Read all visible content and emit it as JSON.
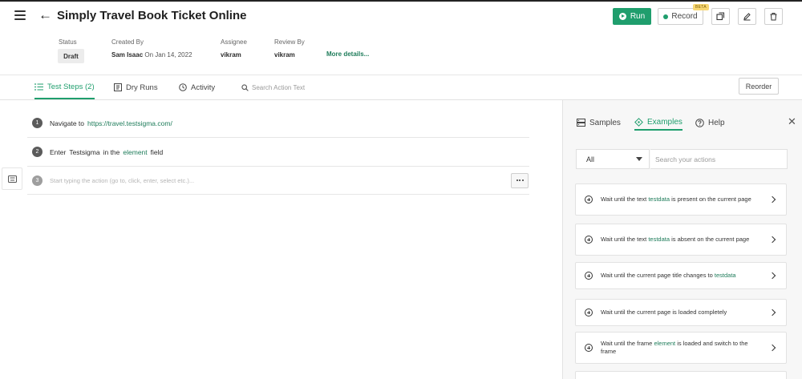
{
  "header": {
    "title": "Simply Travel Book Ticket Online",
    "run_label": "Run",
    "record_label": "Record",
    "beta_label": "BETA"
  },
  "meta": {
    "status_label": "Status",
    "status_value": "Draft",
    "created_label": "Created By",
    "created_by": "Sam Isaac",
    "created_on": "On Jan 14, 2022",
    "assignee_label": "Assignee",
    "assignee": "vikram",
    "review_label": "Review By",
    "reviewer": "vikram",
    "more_details": "More details..."
  },
  "tabs": {
    "test_steps": "Test Steps (2)",
    "dry_runs": "Dry Runs",
    "activity": "Activity",
    "search_placeholder": "Search Action Text",
    "reorder": "Reorder"
  },
  "steps": [
    {
      "num": "1",
      "parts": [
        "Navigate to",
        "https://travel.testsigma.com/"
      ]
    },
    {
      "num": "2",
      "parts": [
        "Enter",
        "Testsigma",
        "in the",
        "element",
        "field"
      ]
    }
  ],
  "new_step": {
    "num": "3",
    "placeholder": "Start typing the action (go to, click, enter, select etc.)..."
  },
  "panel": {
    "tabs": {
      "samples": "Samples",
      "examples": "Examples",
      "help": "Help"
    },
    "filter_value": "All",
    "search_placeholder": "Search your actions",
    "examples": [
      {
        "parts": [
          "Wait until the text",
          "testdata",
          "is present on the current page"
        ]
      },
      {
        "parts": [
          "Wait until the text",
          "testdata",
          "is absent on the current page"
        ]
      },
      {
        "parts": [
          "Wait until the current page title changes to",
          "testdata"
        ]
      },
      {
        "parts": [
          "Wait until the current page is loaded completely"
        ]
      },
      {
        "parts": [
          "Wait until the frame",
          "element",
          "is loaded and switch to the frame"
        ]
      }
    ]
  },
  "colors": {
    "accent": "#1f9e6d",
    "link": "#1e7c5a"
  }
}
